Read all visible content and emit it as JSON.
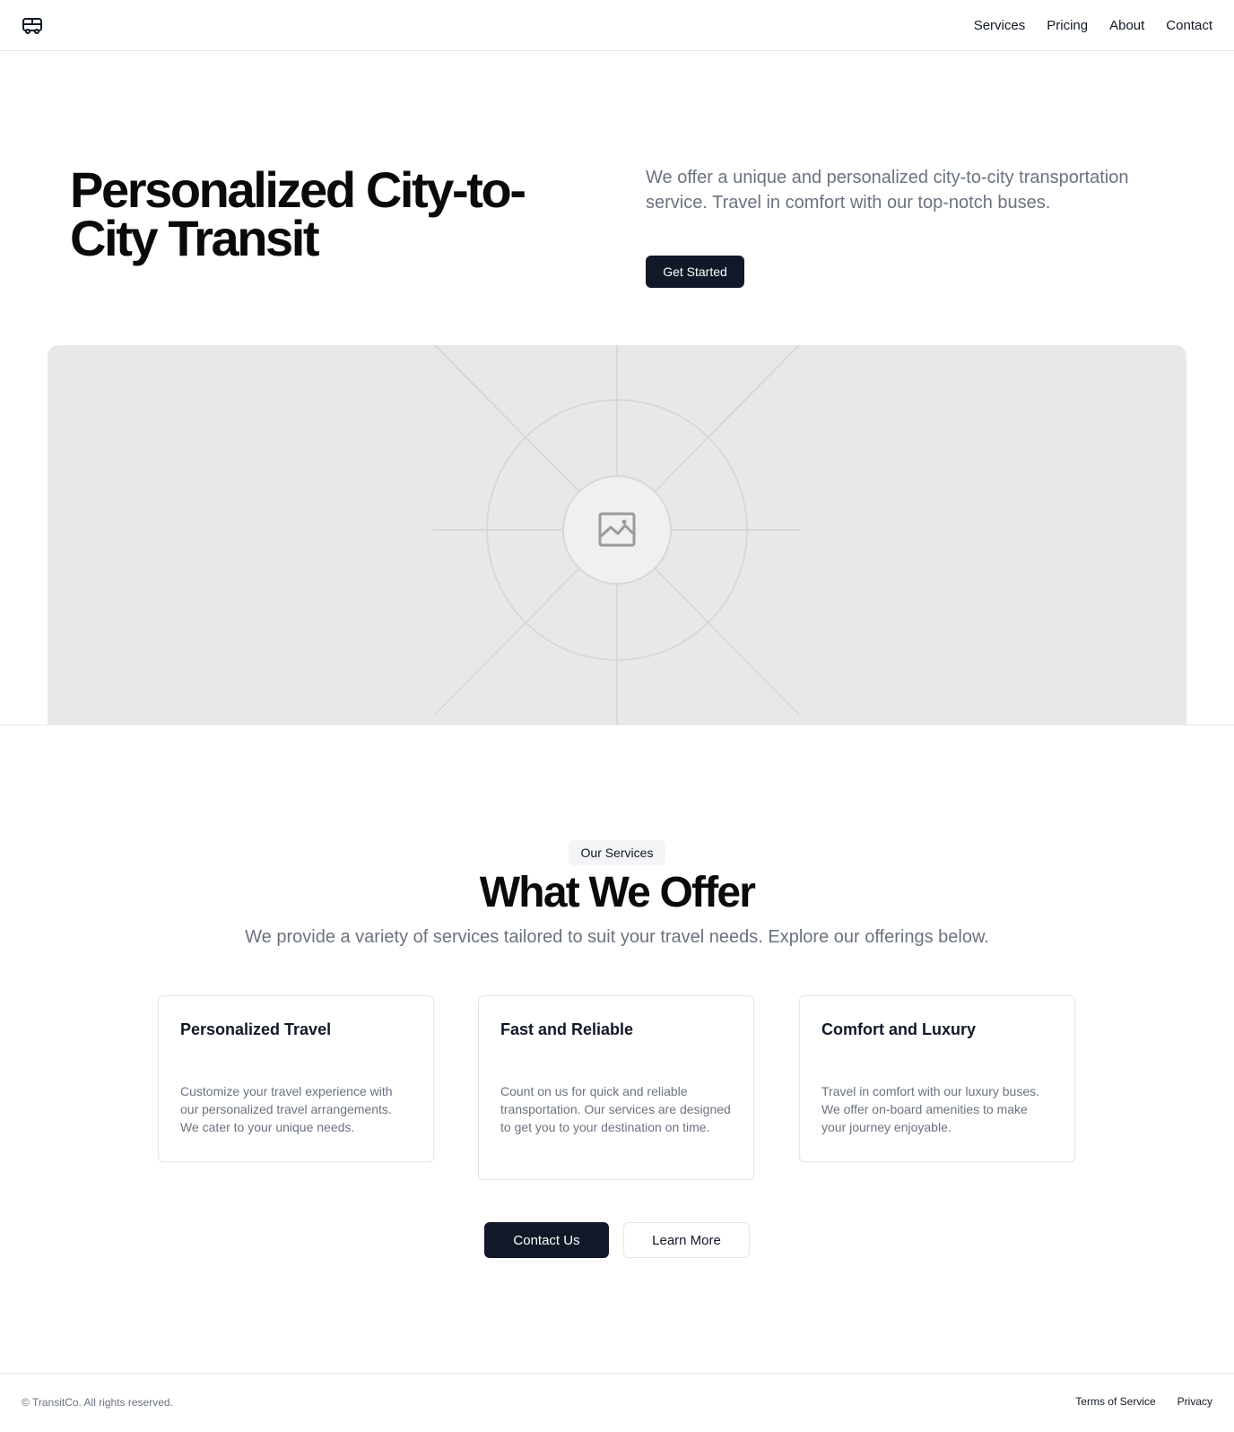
{
  "header": {
    "logo_icon": "bus-icon",
    "nav": [
      {
        "label": "Services"
      },
      {
        "label": "Pricing"
      },
      {
        "label": "About"
      },
      {
        "label": "Contact"
      }
    ]
  },
  "hero": {
    "title": "Personalized City-to-City Transit",
    "description": "We offer a unique and personalized city-to-city transportation service. Travel in comfort with our top-notch buses.",
    "cta_label": "Get Started",
    "image_icon": "image-placeholder-icon"
  },
  "services": {
    "badge": "Our Services",
    "title": "What We Offer",
    "description": "We provide a variety of services tailored to suit your travel needs. Explore our offerings below.",
    "cards": [
      {
        "title": "Personalized Travel",
        "text": "Customize your travel experience with our personalized travel arrangements. We cater to your unique needs."
      },
      {
        "title": "Fast and Reliable",
        "text": "Count on us for quick and reliable transportation. Our services are designed to get you to your destination on time."
      },
      {
        "title": "Comfort and Luxury",
        "text": "Travel in comfort with our luxury buses. We offer on-board amenities to make your journey enjoyable."
      }
    ],
    "primary_cta": "Contact Us",
    "secondary_cta": "Learn More"
  },
  "footer": {
    "copyright": "© TransitCo. All rights reserved.",
    "links": [
      {
        "label": "Terms of Service"
      },
      {
        "label": "Privacy"
      }
    ]
  },
  "colors": {
    "primary": "#111827",
    "muted_text": "#6b7280",
    "border": "#e5e7eb",
    "placeholder_bg": "#e8e8e8"
  }
}
